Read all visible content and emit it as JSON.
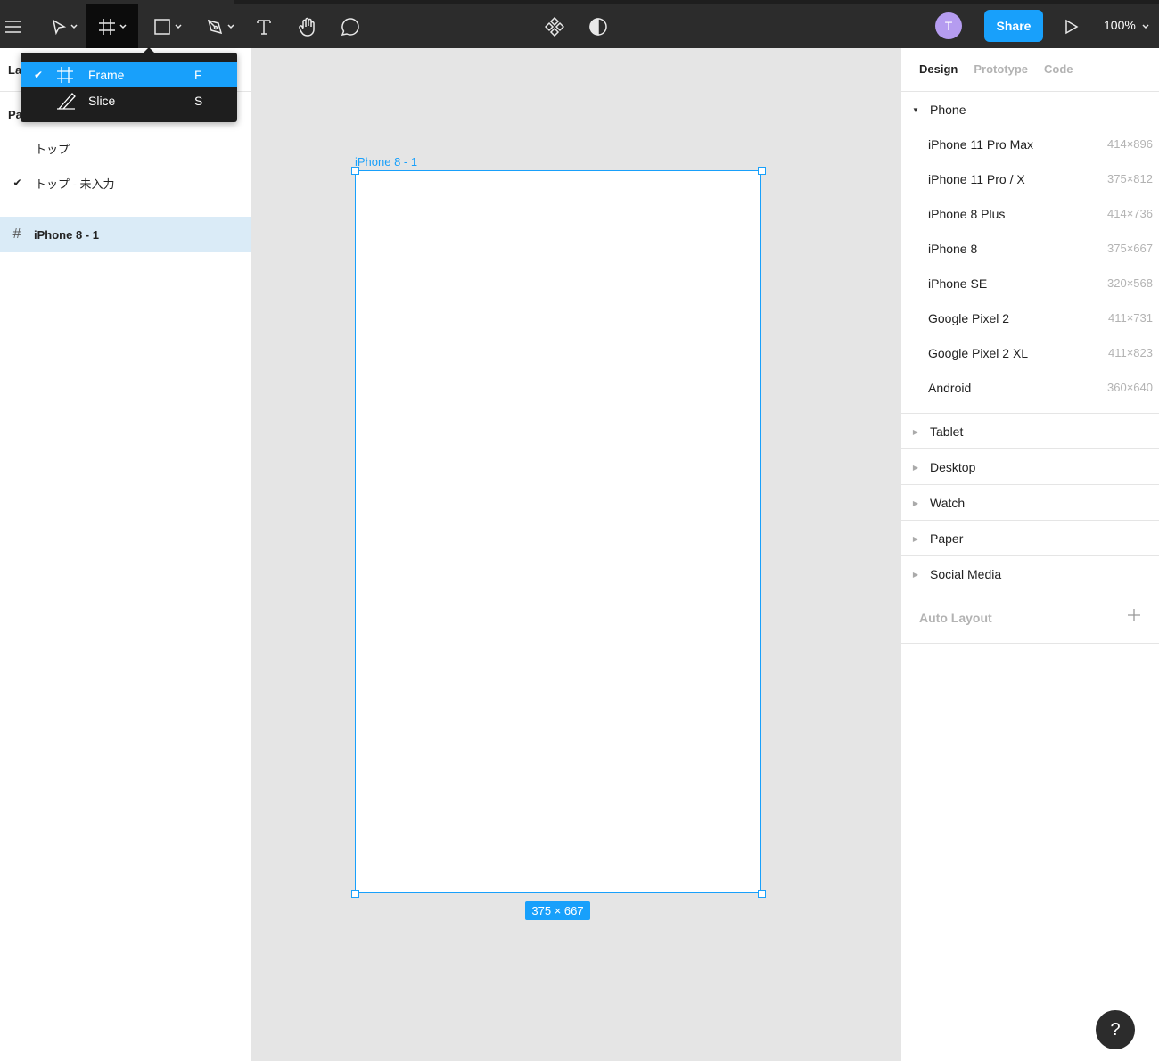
{
  "toolbar": {
    "share_label": "Share",
    "zoom": "100%",
    "avatar_initial": "T"
  },
  "left_panel": {
    "layers_tab": "La",
    "pages_header": "Pa",
    "pages": [
      {
        "label": "トップ",
        "checked": false
      },
      {
        "label": "トップ - 未入力",
        "checked": true
      }
    ],
    "layer": "iPhone 8 - 1"
  },
  "tool_menu": {
    "items": [
      {
        "label": "Frame",
        "shortcut": "F",
        "selected": true
      },
      {
        "label": "Slice",
        "shortcut": "S",
        "selected": false
      }
    ]
  },
  "canvas": {
    "frame_name": "iPhone 8 - 1",
    "frame_size": "375 × 667"
  },
  "right_panel": {
    "tabs": [
      "Design",
      "Prototype",
      "Code"
    ],
    "phone_section": "Phone",
    "phones": [
      {
        "name": "iPhone 11 Pro Max",
        "size": "414×896"
      },
      {
        "name": "iPhone 11 Pro / X",
        "size": "375×812"
      },
      {
        "name": "iPhone 8 Plus",
        "size": "414×736"
      },
      {
        "name": "iPhone 8",
        "size": "375×667"
      },
      {
        "name": "iPhone SE",
        "size": "320×568"
      },
      {
        "name": "Google Pixel 2",
        "size": "411×731"
      },
      {
        "name": "Google Pixel 2 XL",
        "size": "411×823"
      },
      {
        "name": "Android",
        "size": "360×640"
      }
    ],
    "collapsed_sections": [
      "Tablet",
      "Desktop",
      "Watch",
      "Paper",
      "Social Media"
    ],
    "auto_layout": "Auto Layout"
  },
  "help_label": "?",
  "colors": {
    "accent": "#18a0fb",
    "toolbar": "#2c2c2c",
    "selection_row": "#daebf7"
  }
}
